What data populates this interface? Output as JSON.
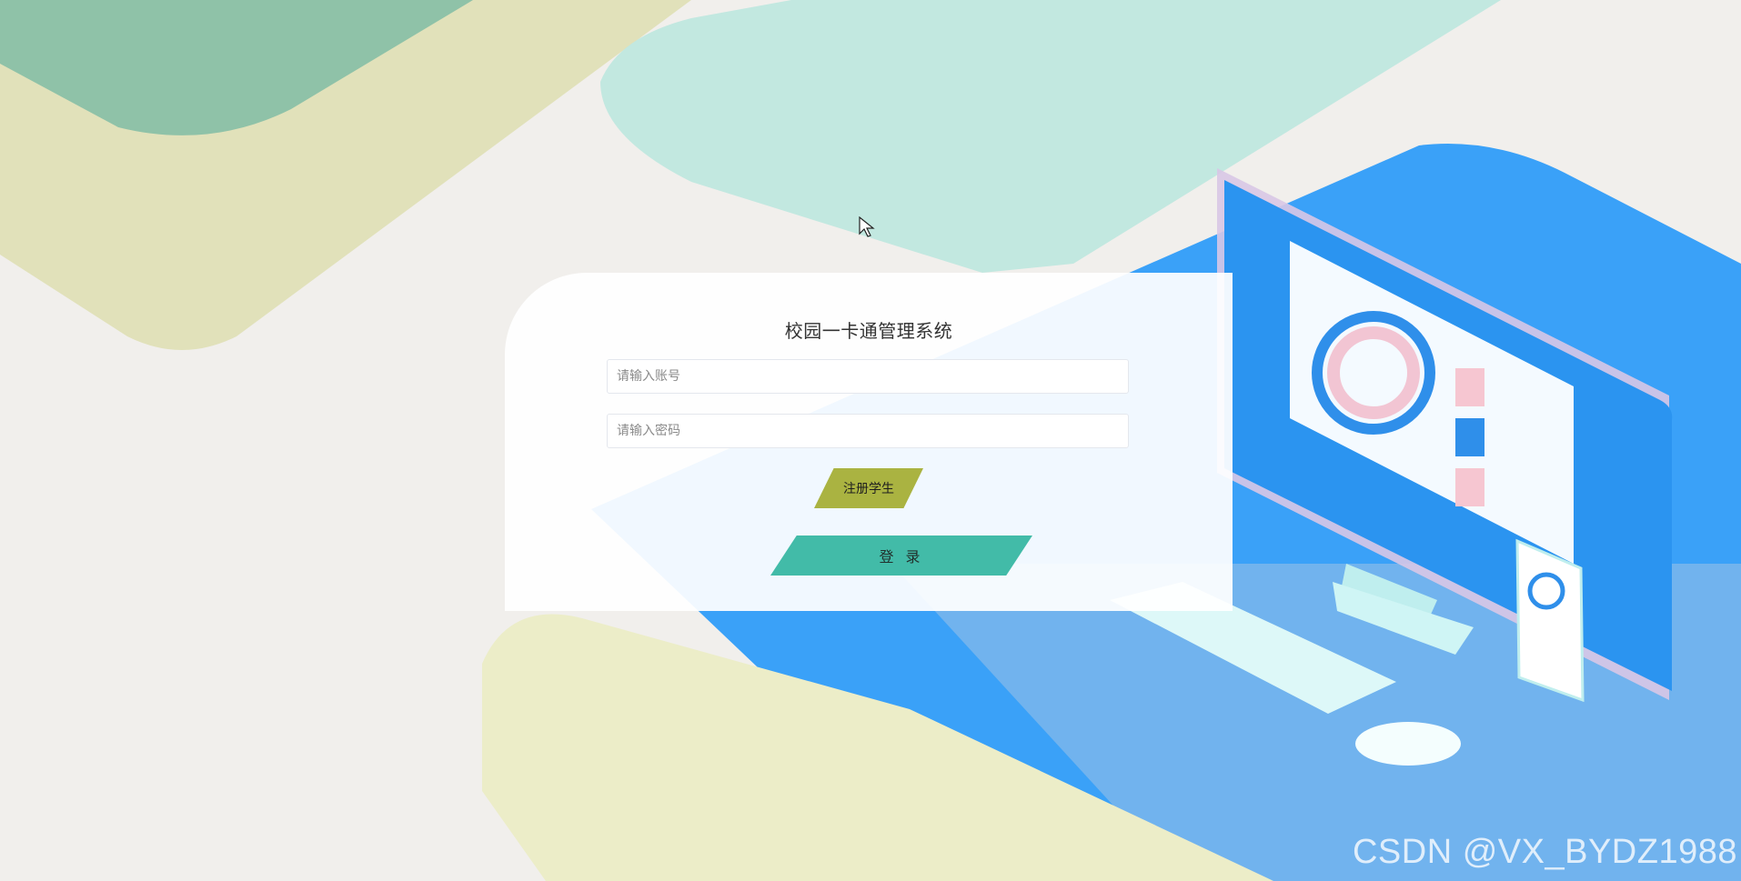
{
  "login": {
    "title": "校园一卡通管理系统",
    "account_placeholder": "请输入账号",
    "password_placeholder": "请输入密码",
    "register_label": "注册学生",
    "login_label": "登 录"
  },
  "watermark": "CSDN @VX_BYDZ1988",
  "colors": {
    "background": "#f1efec",
    "register_button": "#aab341",
    "login_button": "#42bba8",
    "accent_blue": "#3aa1f8",
    "accent_green": "#8fc2a8",
    "accent_yellow": "#e1e1ba",
    "accent_teal": "#bfe7df"
  }
}
